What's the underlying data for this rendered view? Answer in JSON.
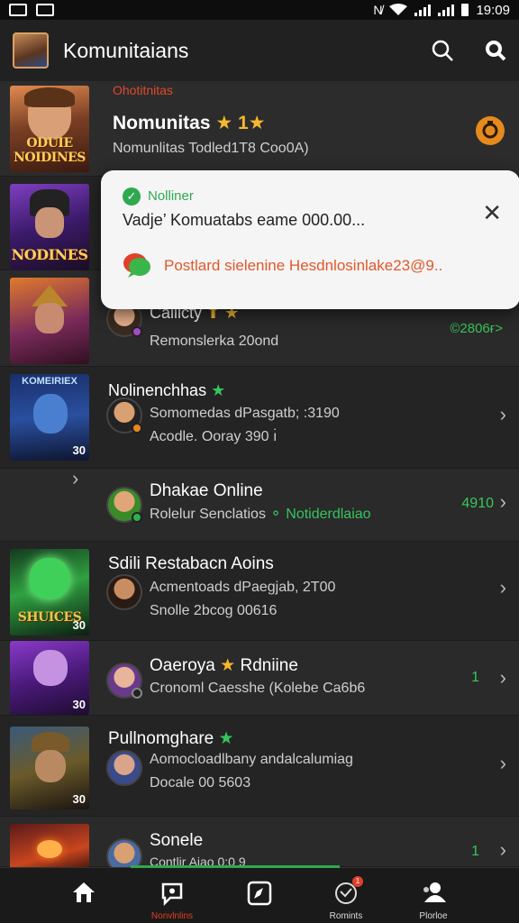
{
  "status_bar": {
    "time": "19:09"
  },
  "app_bar": {
    "title": "Komunitaians"
  },
  "featured": {
    "label": "Ohotitnitas",
    "title": "Nomunitas",
    "stars": "★ 1★",
    "subtitle": "Nomunlitas Todled1T8 Coo0A)"
  },
  "toast": {
    "status": "Nolliner",
    "message": "Vadje’ Komuatabs eame 000.00...",
    "link": "Postlard sielenine Hesdnlosinlake23@9.."
  },
  "rows": [
    {
      "thumb_label": "ODUIE NOIDINES",
      "title": "",
      "subtitle": "",
      "count": "",
      "hidden_under_toast": true
    },
    {
      "thumb_label": "",
      "thumb_num": "",
      "title": "Calilcty",
      "title_suffix": "★",
      "subtitle": "Remonslerka 20ond",
      "count": "©2806ғ>"
    },
    {
      "thumb_label": "KOMEIRIEX",
      "thumb_num": "30",
      "title": "Nolinenchhas",
      "title_suffix": "★",
      "subtitle": "Somomedas dPasgatb; :3190",
      "subtitle2": "Acodle. Ooray 390 ı̇",
      "count": ""
    },
    {
      "thumb_label": "",
      "title": "Dhakae Online",
      "subtitle": "Rolelur Senclatios",
      "subtitle_green": "Notiderdlaiao",
      "count": "4910"
    },
    {
      "thumb_label": "SHUICES",
      "thumb_num": "30",
      "title": "Sdili Restabacn Aoins",
      "subtitle": "Acmentoads dPaegjab, 2T00",
      "subtitle2": "Snolle 2bcog 00616",
      "count": ""
    },
    {
      "thumb_label": "",
      "thumb_num": "30",
      "title": "Oaeroya",
      "title_mid": "★",
      "title_end": "Rdniine",
      "subtitle": "Cronoml Caesshe (Kolebe Ca6b6",
      "count": "1"
    },
    {
      "thumb_label": "",
      "thumb_num": "30",
      "title": "Pullnomghare",
      "title_suffix": "★",
      "subtitle": "Aomocloadlbany andalcalumiag",
      "subtitle2": "Docale 00 5603",
      "count": ""
    },
    {
      "thumb_label": "",
      "title": "Sonele",
      "subtitle": "Contlir Aiao 0:0 9",
      "count": "1"
    }
  ],
  "bottom_nav": [
    {
      "icon": "home-icon",
      "label": ""
    },
    {
      "icon": "chat-icon",
      "label": "Nonvlnlins"
    },
    {
      "icon": "compass-icon",
      "label": ""
    },
    {
      "icon": "heart-icon",
      "label": "Romints",
      "badge": "1"
    },
    {
      "icon": "people-icon",
      "label": "Plorloe"
    }
  ],
  "colors": {
    "accent_green": "#2fa84f",
    "accent_orange": "#e0582c",
    "background": "#262626"
  }
}
